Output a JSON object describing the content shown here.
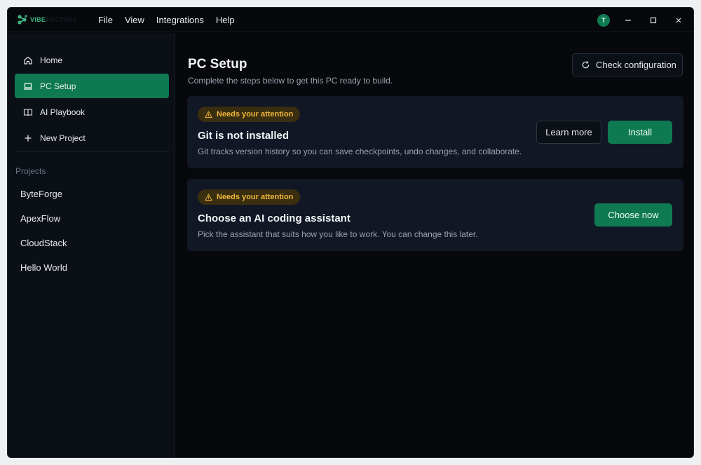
{
  "app": {
    "logo_text_a": "VIBE",
    "logo_text_b": "FACTORY",
    "menu": [
      "File",
      "View",
      "Integrations",
      "Help"
    ],
    "avatar_initial": "T"
  },
  "sidebar": {
    "nav": [
      {
        "label": "Home",
        "icon": "home-icon"
      },
      {
        "label": "PC Setup",
        "icon": "laptop-icon",
        "active": true
      },
      {
        "label": "AI Playbook",
        "icon": "book-icon"
      },
      {
        "label": "New Project",
        "icon": "plus-icon"
      }
    ],
    "projects_label": "Projects",
    "projects": [
      "ByteForge",
      "ApexFlow",
      "CloudStack",
      "Hello World"
    ]
  },
  "main": {
    "title": "PC Setup",
    "subtitle": "Complete the steps below to get this PC ready to build.",
    "check_button": "Check configuration",
    "cards": [
      {
        "badge": "Needs your attention",
        "title": "Git is not installed",
        "description": "Git tracks version history so you can save checkpoints, undo changes, and collaborate.",
        "secondary_action": "Learn more",
        "primary_action": "Install"
      },
      {
        "badge": "Needs your attention",
        "title": "Choose an AI coding assistant",
        "description": "Pick the assistant that suits how you like to work. You can change this later.",
        "primary_action": "Choose now"
      }
    ]
  },
  "colors": {
    "accent": "#0f7a52",
    "warning": "#f0b73a",
    "background": "#06080c",
    "card": "#111725"
  }
}
